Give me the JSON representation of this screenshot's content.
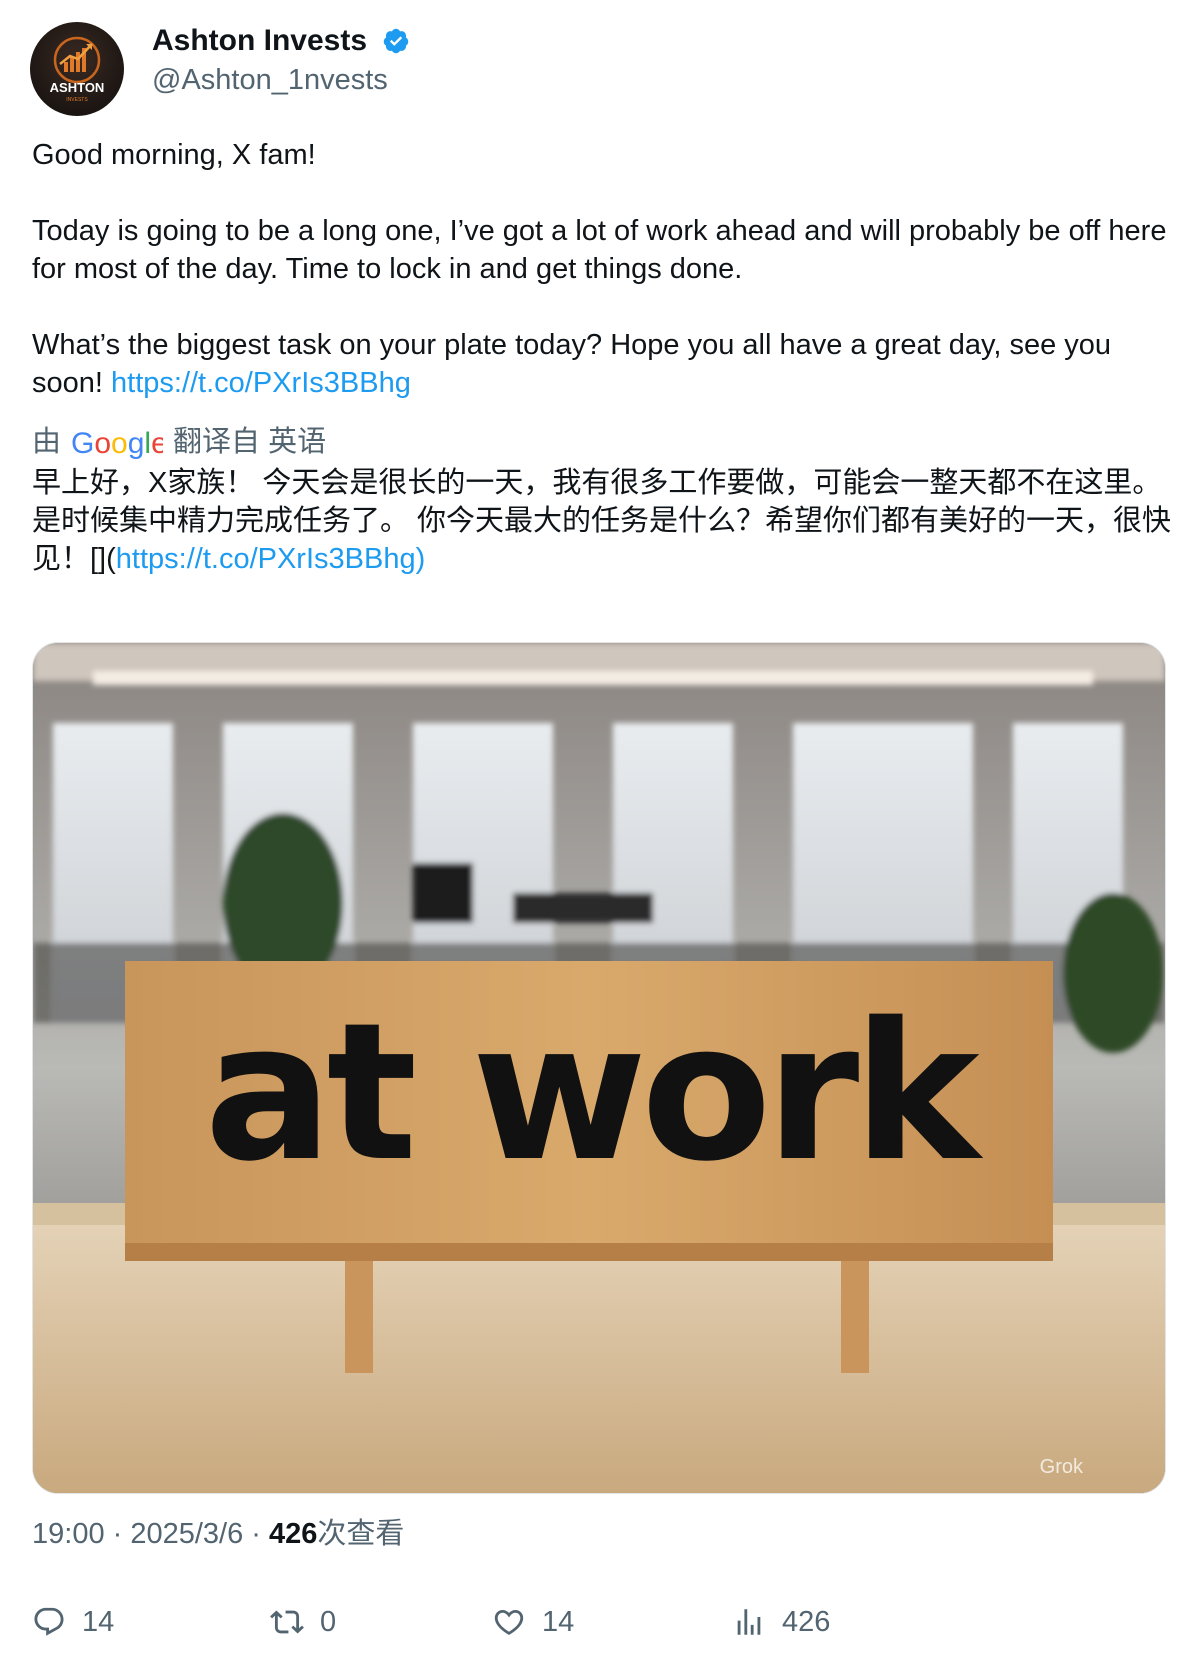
{
  "author": {
    "name": "Ashton Invests",
    "handle": "@Ashton_1nvests",
    "avatar_text": "ASHTON",
    "avatar_subtext": "INVESTS",
    "verified": true
  },
  "tweet": {
    "line1": "Good morning, X fam!",
    "para2": "Today is going to be a long one, I’ve got a lot of work ahead and will probably be off here for most of the day. Time to lock in and get things done.",
    "para3_text": "What’s the biggest task on your plate today? Hope you all have a great day, see you soon!",
    "para3_link": "https://t.co/PXrIs3BBhg"
  },
  "translation": {
    "prefix": "由",
    "provider": "Google",
    "suffix": "翻译自 英语",
    "text": "早上好，X家族！ 今天会是很长的一天，我有很多工作要做，可能会一整天都不在这里。是时候集中精力完成任务了。 你今天最大的任务是什么？希望你们都有美好的一天，很快见！[](",
    "link": "https://t.co/PXrIs3BBhg)"
  },
  "media": {
    "sign_text": "at work",
    "watermark": "Grok"
  },
  "meta": {
    "time": "19:00",
    "sep1": " · ",
    "date": "2025/3/6",
    "sep2": " · ",
    "views_count": "426",
    "views_label": "次查看"
  },
  "actions": {
    "replies": "14",
    "reposts": "0",
    "likes": "14",
    "views": "426"
  },
  "colors": {
    "link": "#1d9bf0",
    "secondary_text": "#536471",
    "verified": "#1d9bf0"
  }
}
